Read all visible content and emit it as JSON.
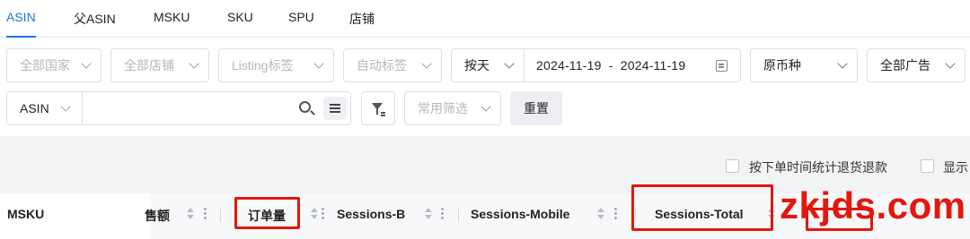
{
  "tabs": [
    {
      "label": "ASIN",
      "active": true
    },
    {
      "label": "父ASIN",
      "active": false
    },
    {
      "label": "MSKU",
      "active": false
    },
    {
      "label": "SKU",
      "active": false
    },
    {
      "label": "SPU",
      "active": false
    },
    {
      "label": "店铺",
      "active": false
    }
  ],
  "filters": {
    "country": "全部国家",
    "store": "全部店铺",
    "listing_tag": "Listing标签",
    "auto_tag": "自动标签",
    "granularity": "按天",
    "date_range": "2024-11-19  -  2024-11-19",
    "currency": "原币种",
    "ads": "全部广告"
  },
  "search": {
    "field": "ASIN",
    "placeholder": ""
  },
  "common_filter": "常用筛选",
  "reset_label": "重置",
  "options": {
    "refund_by_order_time": "按下单时间统计退货退款",
    "show": "显示"
  },
  "columns": {
    "msku": "MSKU",
    "sales": "售额",
    "orders": "订单量",
    "sessions_b": "Sessions-B",
    "sessions_mobile": "Sessions-Mobile",
    "sessions_total": "Sessions-Total"
  },
  "watermark": "zkjds.com",
  "colors": {
    "accent": "#1a73e8",
    "highlight_box": "#e3170d"
  }
}
